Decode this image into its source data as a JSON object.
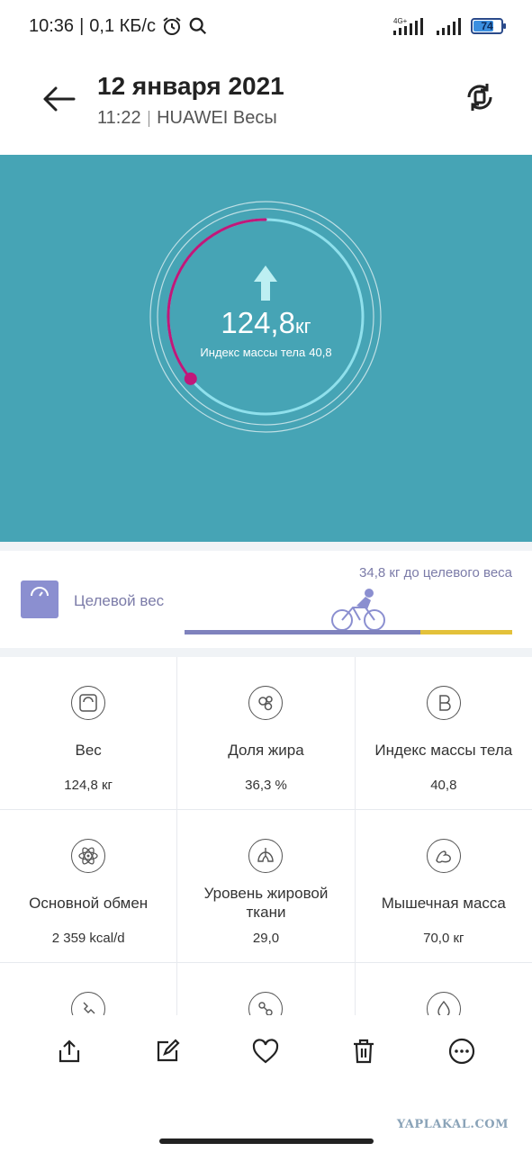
{
  "status_bar": {
    "time": "10:36",
    "speed": "0,1 КБ/с",
    "network_label": "4G+",
    "battery_level": "74",
    "icons": [
      "alarm-icon",
      "search-icon",
      "signal-icon",
      "battery-icon"
    ]
  },
  "header": {
    "date": "12 января 2021",
    "time": "11:22",
    "device": "HUAWEI Весы",
    "icons": [
      "back-arrow-icon",
      "sync-icon"
    ]
  },
  "hero": {
    "weight_value": "124,8",
    "weight_unit": "кг",
    "bmi_label": "Индекс массы тела",
    "bmi_value": "40,8",
    "arc_progress": 0.36,
    "colors": {
      "background": "#46a4b5",
      "arc": "#c0187a",
      "track": "#8fe0ec"
    }
  },
  "goal": {
    "label": "Целевой вес",
    "remaining_text": "34,8 кг до целевого веса",
    "progress": 0.72,
    "colors": {
      "done": "#7f82bd",
      "rest": "#e3c13a"
    }
  },
  "metrics": [
    {
      "icon": "scale-icon",
      "label": "Вес",
      "value": "124,8 кг"
    },
    {
      "icon": "fat-cells-icon",
      "label": "Доля жира",
      "value": "36,3 %"
    },
    {
      "icon": "bmi-b-icon",
      "label": "Индекс массы тела",
      "value": "40,8"
    },
    {
      "icon": "atom-icon",
      "label": "Основной обмен",
      "value": "2 359 kcal/d"
    },
    {
      "icon": "visceral-fat-icon",
      "label": "Уровень жировой ткани",
      "value": "29,0"
    },
    {
      "icon": "muscle-icon",
      "label": "Мышечная масса",
      "value": "70,0 кг"
    },
    {
      "icon": "bone-icon",
      "label": "",
      "value": ""
    },
    {
      "icon": "protein-icon",
      "label": "",
      "value": ""
    },
    {
      "icon": "water-drop-icon",
      "label": "",
      "value": ""
    }
  ],
  "actions": [
    "share-icon",
    "edit-icon",
    "heart-icon",
    "delete-icon",
    "more-icon"
  ],
  "watermark": "YAPLAKAL.COM"
}
